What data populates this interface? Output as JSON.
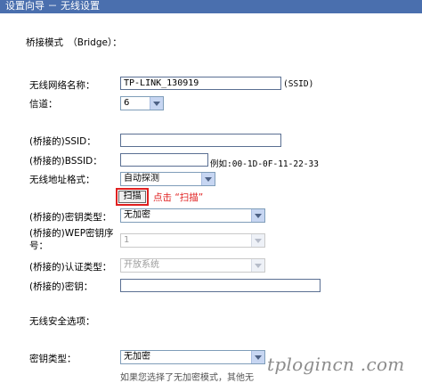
{
  "title": "设置向导 － 无线设置",
  "bridge_mode": "桥接模式　（Bridge）：",
  "fields": {
    "ssid_label": "无线网络名称：",
    "ssid_value": "TP-LINK_130919",
    "ssid_suffix": "(SSID)",
    "channel_label": "信道：",
    "channel_value": "6",
    "bridge_ssid_label": "(桥接的)SSID：",
    "bridge_ssid_value": "",
    "bridge_bssid_label": "(桥接的)BSSID：",
    "bridge_bssid_value": "",
    "bssid_example": "例如:00-1D-0F-11-22-33",
    "addr_format_label": "无线地址格式：",
    "addr_format_value": "自动探测",
    "scan_button": "扫描",
    "scan_hint": "点击 “扫描”",
    "key_type_label": "(桥接的)密钥类型：",
    "key_type_value": "无加密",
    "wep_index_label": "(桥接的)WEP密钥序号：",
    "wep_index_value": "1",
    "auth_type_label": "(桥接的)认证类型：",
    "auth_type_value": "开放系统",
    "key_label": "(桥接的)密钥：",
    "key_value": ""
  },
  "security": {
    "section_label": "无线安全选项：",
    "key_type_label": "密钥类型：",
    "key_type_value": "无加密",
    "note": "如果您选择了无加密模式，其他无"
  },
  "watermark": "tplogincn .com",
  "colors": {
    "titlebar": "#4a6fae",
    "hint_red": "#e02020"
  }
}
